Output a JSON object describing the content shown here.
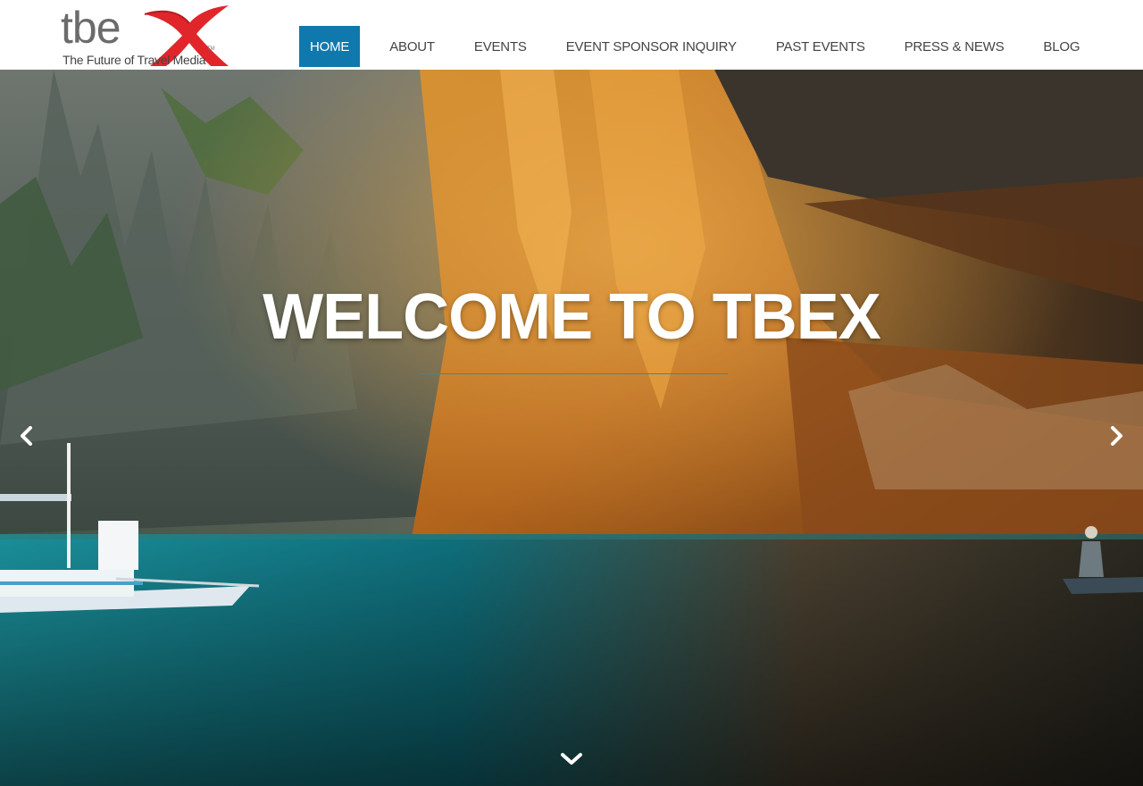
{
  "site": {
    "logo_text": "tbe",
    "logo_tagline": "The Future of Travel Media",
    "logo_tm": "TM"
  },
  "nav": {
    "items": [
      {
        "label": "HOME",
        "active": true
      },
      {
        "label": "ABOUT",
        "active": false
      },
      {
        "label": "EVENTS",
        "active": false
      },
      {
        "label": "EVENT SPONSOR INQUIRY",
        "active": false
      },
      {
        "label": "PAST EVENTS",
        "active": false
      },
      {
        "label": "PRESS & NEWS",
        "active": false
      },
      {
        "label": "BLOG",
        "active": false
      }
    ]
  },
  "hero": {
    "title": "WELCOME TO TBEX",
    "prev_icon": "chevron-left-icon",
    "next_icon": "chevron-right-icon",
    "scroll_icon": "chevron-down-icon"
  },
  "colors": {
    "nav_active": "#0f79ad",
    "logo_red": "#e0262b",
    "divider": "#1f8fc4"
  }
}
